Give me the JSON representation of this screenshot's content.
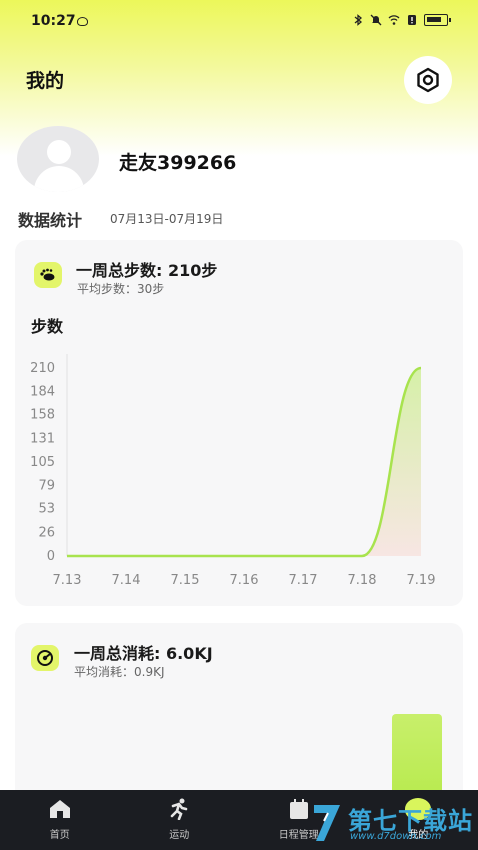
{
  "status_bar": {
    "time": "10:27"
  },
  "header": {
    "title": "我的"
  },
  "profile": {
    "username": "走友399266"
  },
  "stats": {
    "section_title": "数据统计",
    "date_range": "07月13日-07月19日"
  },
  "steps_card": {
    "title": "一周总步数: 210步",
    "subtitle": "平均步数：30步",
    "chart_title": "步数"
  },
  "energy_card": {
    "title": "一周总消耗: 6.0KJ",
    "subtitle": "平均消耗：0.9KJ"
  },
  "chart_data": [
    {
      "type": "area",
      "title": "步数",
      "x": [
        "7.13",
        "7.14",
        "7.15",
        "7.16",
        "7.17",
        "7.18",
        "7.19"
      ],
      "values": [
        0,
        0,
        0,
        0,
        0,
        0,
        210
      ],
      "yticks": [
        0,
        26,
        53,
        79,
        105,
        131,
        158,
        184,
        210
      ],
      "ylim": [
        0,
        210
      ],
      "grid": false,
      "colors": {
        "line": "#a8e34e",
        "fill_top": "#d6f0a8",
        "fill_bottom": "#f7e6e3"
      }
    },
    {
      "type": "bar",
      "x": [
        "7.13",
        "7.14",
        "7.15",
        "7.16",
        "7.17",
        "7.18",
        "7.19"
      ],
      "values": [
        0,
        0,
        0,
        0,
        0,
        0,
        6.0
      ],
      "colors": {
        "bar": "#b9ea52"
      }
    }
  ],
  "bottom_nav": {
    "items": [
      {
        "label": "首页",
        "icon": "home-icon"
      },
      {
        "label": "运动",
        "icon": "running-icon"
      },
      {
        "label": "日程管理",
        "icon": "calendar-icon"
      },
      {
        "label": "我的",
        "icon": "profile-icon"
      }
    ]
  },
  "watermark": {
    "brand": "第七下载站",
    "url": "www.d7down.com"
  },
  "colors": {
    "accent": "#d9f55c",
    "nav_bg": "#1b1d22",
    "card_bg": "#f7f7f8"
  }
}
